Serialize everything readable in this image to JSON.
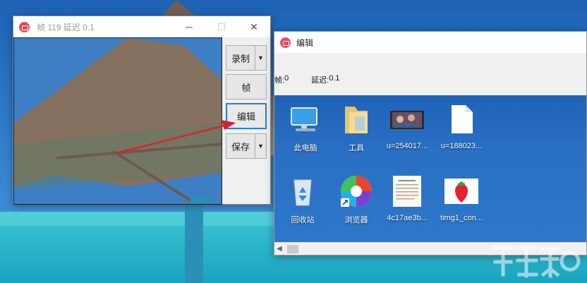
{
  "recorder": {
    "title": "帧 119 延迟 0.1",
    "controls": {
      "minimize": "─",
      "maximize": "☐",
      "close": "✕"
    },
    "buttons": {
      "record": "录制",
      "frame": "帧",
      "edit": "编辑",
      "save": "保存"
    }
  },
  "editor": {
    "title": "编辑",
    "frame_label": "帧:",
    "frame_value": "0",
    "delay_label": "延迟:",
    "delay_value": "0.1",
    "desktop_items": [
      {
        "label": "此电脑",
        "icon": "computer-icon"
      },
      {
        "label": "工具",
        "icon": "folder-icon"
      },
      {
        "label": "u=254017...",
        "icon": "image-thumbnail-icon"
      },
      {
        "label": "u=188023...",
        "icon": "blank-file-icon"
      },
      {
        "label": "回收站",
        "icon": "recycle-bin-icon"
      },
      {
        "label": "浏览器",
        "icon": "browser-icon"
      },
      {
        "label": "4c17ae3b...",
        "icon": "document-thumbnail-icon"
      },
      {
        "label": "timg1_con...",
        "icon": "strawberry-image-icon"
      }
    ]
  },
  "colors": {
    "accent": "#e34b5f",
    "focus_border": "#2f7bd1",
    "annotation_arrow": "#d8232a",
    "desktop_bg": "#2a70c4"
  }
}
